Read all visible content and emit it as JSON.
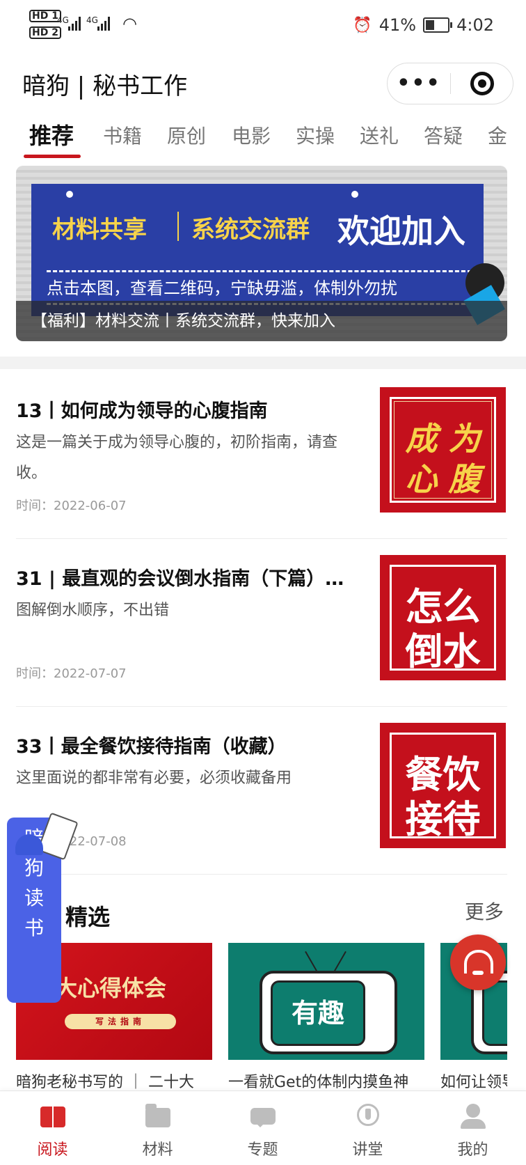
{
  "status_bar": {
    "sim1": "HD 1",
    "sim2": "HD 2",
    "net1": "4G",
    "net2": "4G",
    "battery_pct": "41%",
    "time": "4:02",
    "icons": [
      "alarm-icon",
      "wifi-icon",
      "battery-charging-icon"
    ]
  },
  "header": {
    "title": "暗狗 | 秘书工作",
    "menu_label": "•••"
  },
  "tabs": [
    "推荐",
    "书籍",
    "原创",
    "电影",
    "实操",
    "送礼",
    "答疑",
    "金"
  ],
  "active_tab": 0,
  "banner": {
    "text1": "材料共享",
    "text2": "系统交流群",
    "text3": "欢迎加入",
    "subtitle": "点击本图，查看二维码，宁缺毋滥，体制外勿扰",
    "caption": "【福利】材料交流丨系统交流群，快来加入"
  },
  "articles": [
    {
      "title": "13丨如何成为领导的心腹指南",
      "desc": "这是一篇关于成为领导心腹的，初阶指南，请查收。",
      "time": "时间：2022-06-07",
      "thumb_text": [
        "成 为",
        "心 腹"
      ]
    },
    {
      "title": "31 | 最直观的会议倒水指南（下篇）…",
      "desc": "图解倒水顺序，不出错",
      "time": "时间：2022-07-07",
      "thumb_text": [
        "怎么",
        "倒水"
      ]
    },
    {
      "title": "33丨最全餐饮接待指南（收藏）",
      "desc": "这里面说的都非常有必要，必须收藏备用",
      "time": "时间：2022-07-08",
      "thumb_text": [
        "餐饮",
        "接待"
      ]
    }
  ],
  "float_badge": [
    "暗",
    "狗",
    "读",
    "书"
  ],
  "section": {
    "title": "精选",
    "more": "更多"
  },
  "cards": [
    {
      "image_title": "十大心得体会",
      "image_tag": "写法指南",
      "caption": "暗狗老秘书写的 ｜ 二十大"
    },
    {
      "image_title": "有趣",
      "caption": "一看就Get的体制内摸鱼神"
    },
    {
      "image_title": "有",
      "caption": "如何让领导"
    }
  ],
  "nav": [
    {
      "label": "阅读",
      "icon": "book-icon",
      "active": true
    },
    {
      "label": "材料",
      "icon": "folder-icon",
      "active": false
    },
    {
      "label": "专题",
      "icon": "chat-icon",
      "active": false
    },
    {
      "label": "讲堂",
      "icon": "lecture-pen-icon",
      "active": false
    },
    {
      "label": "我的",
      "icon": "user-icon",
      "active": false
    }
  ],
  "colors": {
    "accent": "#c8161d",
    "banner_blue": "#2a3fa5",
    "float_blue": "#4b62e6",
    "card_green": "#0d7d6e",
    "help_red": "#d8352a"
  }
}
